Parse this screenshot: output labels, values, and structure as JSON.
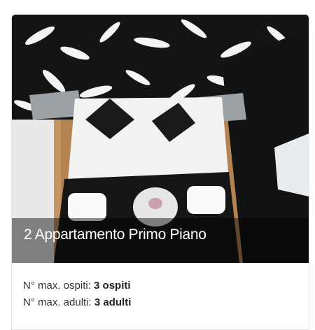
{
  "card": {
    "title": "2 Appartamento Primo Piano",
    "details": [
      {
        "label": "N° max. ospiti:",
        "value": "3 ospiti"
      },
      {
        "label": "N° max. adulti:",
        "value": "3 adulti"
      }
    ]
  },
  "colors": {
    "overlay": "rgba(0,0,0,0.45)",
    "floor": "#b98a55",
    "wall_pattern_dark": "#141414",
    "bed_linen": "#f2f2f2",
    "text": "#333333"
  },
  "photo": {
    "subject": "hotel-room-photo"
  }
}
